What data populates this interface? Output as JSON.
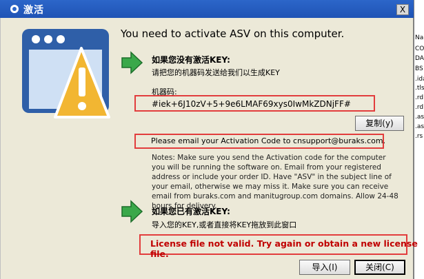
{
  "window": {
    "title": "激活",
    "close_label": "X"
  },
  "header": {
    "headline": "You need to activate ASV on this computer."
  },
  "no_key": {
    "title": "如果您没有激活KEY:",
    "subtitle": "请把您的机器码发送给我们以生成KEY",
    "machine_code_label": "机器码:",
    "machine_code": "#iek+6J10zV+5+9e6LMAF69xys0IwMkZDNjFF#",
    "copy_button": "复制(y)",
    "email_line": "Please email your Activation Code to cnsupport@buraks.com.",
    "notes": "Notes: Make sure you send the Activation code for the computer you will be running the software on. Email from your registered address or include your order ID. Have \"ASV\" in the subject line of your email, otherwise we may miss it. Make sure you can receive email from buraks.com and manitugroup.com domains. Allow 24-48 hours for delivery."
  },
  "have_key": {
    "title": "如果您已有激活KEY:",
    "subtitle": "导入您的KEY,或者直接将KEY拖放到此窗口"
  },
  "error_text": "License file not valid. Try again or obtain a new license file.",
  "buttons": {
    "import": "导入(I)",
    "close": "关闭(C)"
  },
  "side_panel": {
    "items": [
      "Na",
      "CO",
      "DA",
      "BS",
      ".ida",
      ".tls",
      ".rd",
      ".rd",
      ".as",
      ".as",
      ".rs"
    ]
  },
  "colors": {
    "title_bar": "#2c66c9",
    "highlight_box": "#e23c3c",
    "error_text": "#c00000",
    "arrow": "#3aa84a"
  }
}
